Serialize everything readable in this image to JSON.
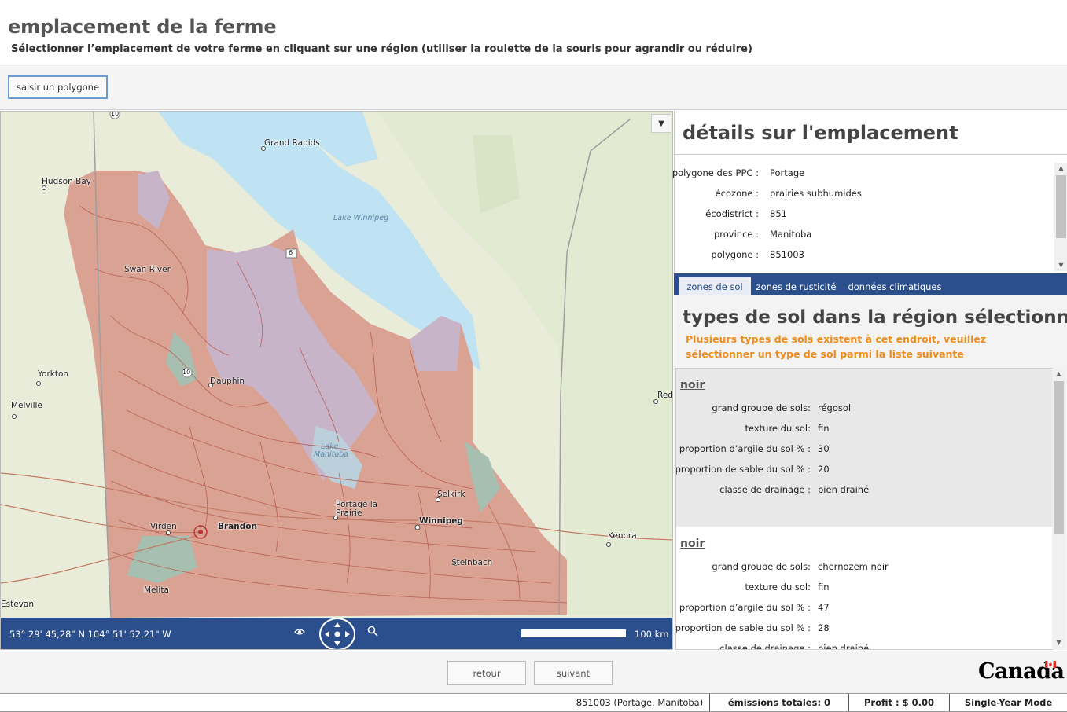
{
  "header": {
    "title": "emplacement de la ferme",
    "subtitle": "Sélectionner l’emplacement de votre ferme en cliquant sur une région (utiliser la roulette de la souris pour agrandir ou réduire)"
  },
  "toolbar": {
    "polygon_button": "saisir un polygone"
  },
  "map": {
    "dropdown_glyph": "▼",
    "labels": {
      "grand_rapids": "Grand Rapids",
      "hudson_bay": "Hudson Bay",
      "lake_winnipeg": "Lake Winnipeg",
      "swan_river": "Swan River",
      "yorkton": "Yorkton",
      "melville": "Melville",
      "dauphin": "Dauphin",
      "lake_manitoba_1": "Lake",
      "lake_manitoba_2": "Manitoba",
      "selkirk": "Selkirk",
      "portage_1": "Portage la",
      "portage_2": "Prairie",
      "winnipeg": "Winnipeg",
      "virden": "Virden",
      "brandon": "Brandon",
      "kenora": "Kenora",
      "steinbach": "Steinbach",
      "estevan": "Estevan",
      "melita": "Melita",
      "red": "Red",
      "hwy6": "6",
      "hwy10": "10",
      "hwy10b": "10"
    },
    "coords": "53° 29' 45,28\" N 104° 51' 52,21\" W",
    "scale": "100 km",
    "icons": {
      "visibility": "eye-icon",
      "pan": "pan-control-icon",
      "zoom": "magnifier-icon"
    }
  },
  "details": {
    "title": "détails sur l'emplacement",
    "fields": [
      {
        "label": "polygone des PPC :",
        "value": "Portage"
      },
      {
        "label": "écozone :",
        "value": "prairies subhumides"
      },
      {
        "label": "écodistrict :",
        "value": "851"
      },
      {
        "label": "province :",
        "value": "Manitoba"
      },
      {
        "label": "polygone :",
        "value": "851003"
      }
    ]
  },
  "tabs": [
    {
      "label": "zones de sol",
      "active": true
    },
    {
      "label": "zones de rusticité",
      "active": false
    },
    {
      "label": "données climatiques",
      "active": false
    }
  ],
  "soil": {
    "title": "types de sol dans la région sélectionnée",
    "warning": "Plusieurs types de sols existent à cet endroit, veuillez sélectionner un type de sol parmi la liste suivante",
    "cards": [
      {
        "name": "noir",
        "rows": [
          {
            "label": "grand groupe de sols:",
            "value": "régosol"
          },
          {
            "label": "texture du sol:",
            "value": "fin"
          },
          {
            "label": "proportion d’argile du sol % :",
            "value": "30"
          },
          {
            "label": "proportion de sable du sol % :",
            "value": "20"
          },
          {
            "label": "classe de drainage :",
            "value": " bien drainé"
          }
        ]
      },
      {
        "name": "noir",
        "rows": [
          {
            "label": "grand groupe de sols:",
            "value": "chernozem noir"
          },
          {
            "label": "texture du sol:",
            "value": "fin"
          },
          {
            "label": "proportion d’argile du sol % :",
            "value": "47"
          },
          {
            "label": "proportion de sable du sol % :",
            "value": "28"
          },
          {
            "label": "classe de drainage :",
            "value": " bien drainé"
          }
        ]
      }
    ]
  },
  "footer": {
    "back": "retour",
    "next": "suivant",
    "wordmark": "Canada"
  },
  "status": {
    "polygon": "851003 (Portage, Manitoba)",
    "emissions": "émissions totales: 0",
    "profit": "Profit :  $ 0.00",
    "mode": "Single-Year Mode"
  },
  "colors": {
    "accent": "#2b4f8c",
    "warning": "#f08c1e",
    "water": "#bfe3f2",
    "soil": "#d9a292",
    "soil_line": "#b5544c",
    "highlight_polygon": "#c8b4c8"
  }
}
